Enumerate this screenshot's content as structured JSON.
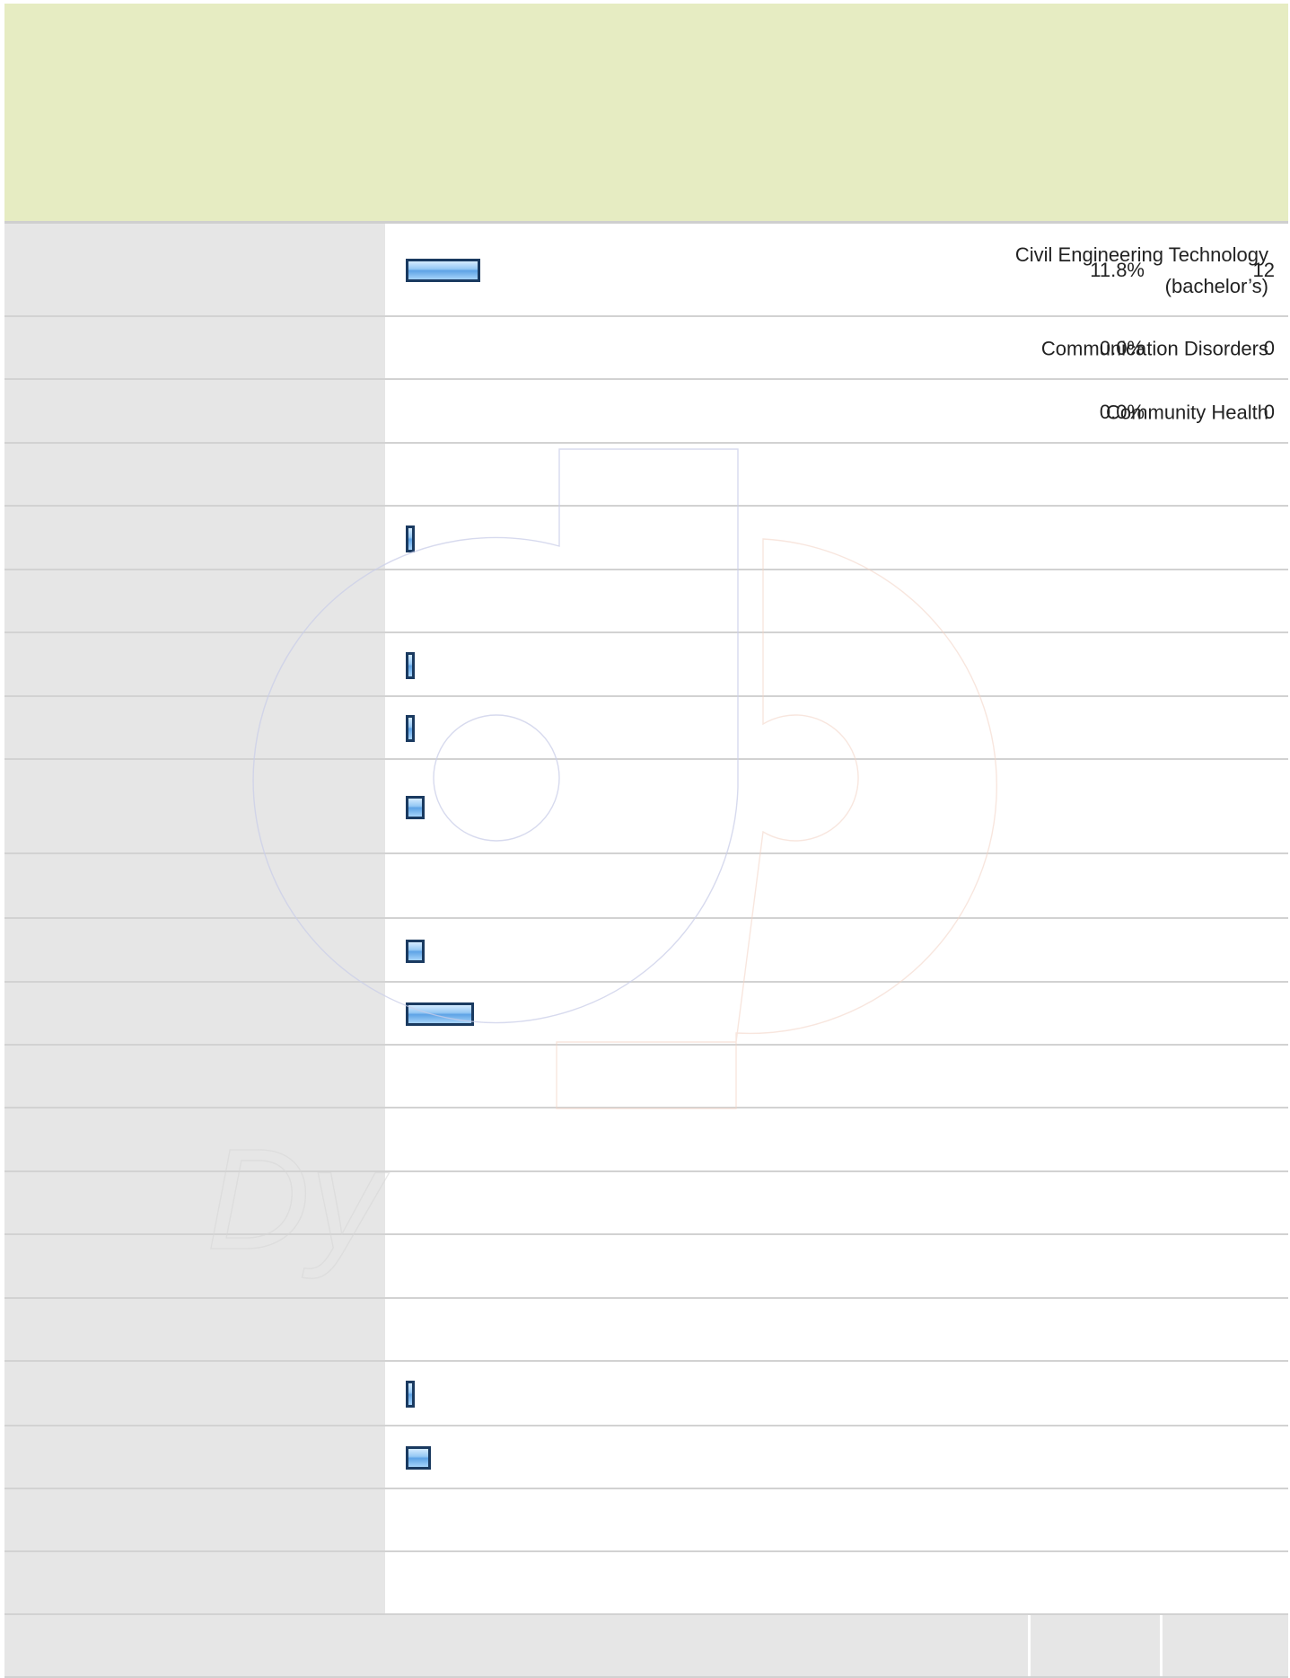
{
  "chart_data": {
    "type": "bar",
    "orientation": "horizontal",
    "categories": [
      "Civil Engineering Technology (bachelor’s)",
      "Communication Disorders",
      "Community Health",
      "",
      "",
      "",
      "",
      "",
      "",
      "",
      "",
      "",
      "",
      "",
      "",
      "",
      "",
      "",
      "",
      "",
      ""
    ],
    "percents": [
      "11.8%",
      "0.0%",
      "0.0%",
      "",
      "",
      "",
      "",
      "",
      "",
      "",
      "",
      "",
      "",
      "",
      "",
      "",
      "",
      "",
      "",
      "",
      ""
    ],
    "counts": [
      "12",
      "0",
      "0",
      "",
      "",
      "",
      "",
      "",
      "",
      "",
      "",
      "",
      "",
      "",
      "",
      "",
      "",
      "",
      "",
      "",
      ""
    ],
    "values": [
      11.8,
      0,
      0,
      null,
      1,
      null,
      1,
      1,
      3,
      null,
      3,
      10.8,
      null,
      null,
      null,
      null,
      null,
      1,
      4,
      null,
      null
    ],
    "xlim": [
      0,
      100
    ],
    "grid": false,
    "legend": "none",
    "colors": {
      "bar_fill": "#8ec4f2",
      "bar_border": "#1a3a60",
      "header": "#e6ecc2",
      "label_bg": "#e6e6e6"
    }
  }
}
